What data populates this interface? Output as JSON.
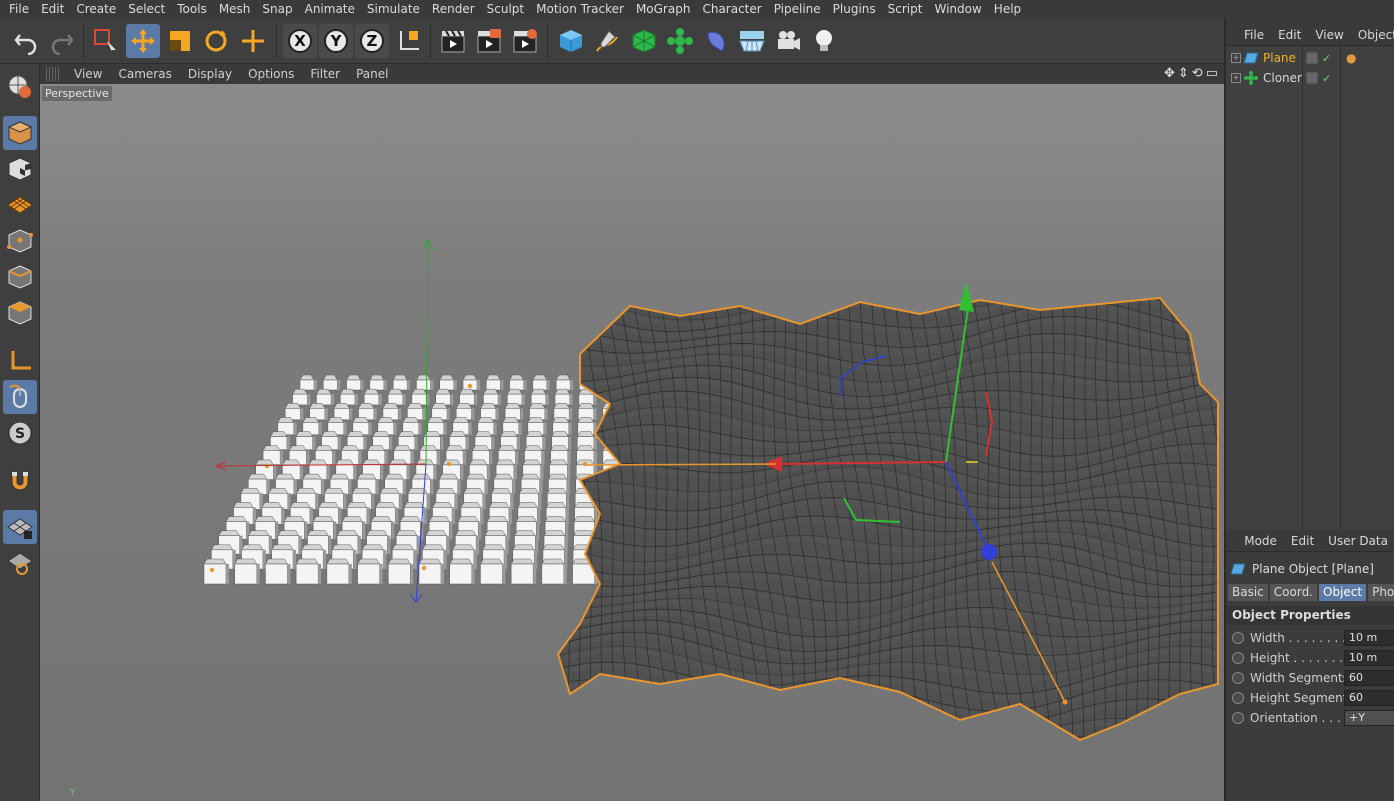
{
  "menu": [
    "File",
    "Edit",
    "Create",
    "Select",
    "Tools",
    "Mesh",
    "Snap",
    "Animate",
    "Simulate",
    "Render",
    "Sculpt",
    "Motion Tracker",
    "MoGraph",
    "Character",
    "Pipeline",
    "Plugins",
    "Script",
    "Window",
    "Help"
  ],
  "toolbar": {
    "axis_x": "X",
    "axis_y": "Y",
    "axis_z": "Z"
  },
  "viewport": {
    "menu": [
      "View",
      "Cameras",
      "Display",
      "Options",
      "Filter",
      "Panel"
    ],
    "label": "Perspective",
    "axis_letter": "Y"
  },
  "objects_panel": {
    "menu": [
      "File",
      "Edit",
      "View",
      "Objects"
    ],
    "items": [
      {
        "name": "Plane",
        "color": "#f0b030",
        "expander": "+"
      },
      {
        "name": "Cloner",
        "color": "#d8d8d8",
        "expander": "+"
      }
    ],
    "check_mark": "✓"
  },
  "attributes_panel": {
    "menu": [
      "Mode",
      "Edit",
      "User Data"
    ],
    "title": "Plane Object [Plane]",
    "tabs": [
      {
        "label": "Basic",
        "active": false
      },
      {
        "label": "Coord.",
        "active": false
      },
      {
        "label": "Object",
        "active": true
      },
      {
        "label": "Phong",
        "active": false
      }
    ],
    "section": "Object Properties",
    "fields": [
      {
        "label": "Width . . . . . . . . . .",
        "value": "10 m"
      },
      {
        "label": "Height . . . . . . . . .",
        "value": "10 m"
      },
      {
        "label": "Width Segments",
        "value": "60"
      },
      {
        "label": "Height Segments",
        "value": "60"
      },
      {
        "label": "Orientation . . . .",
        "value": "+Y"
      }
    ]
  },
  "colors": {
    "accent": "#5b7aa6",
    "selection_outline": "#e8962e",
    "axis_x": "#d83030",
    "axis_y": "#30c030",
    "axis_z": "#3040d8"
  }
}
